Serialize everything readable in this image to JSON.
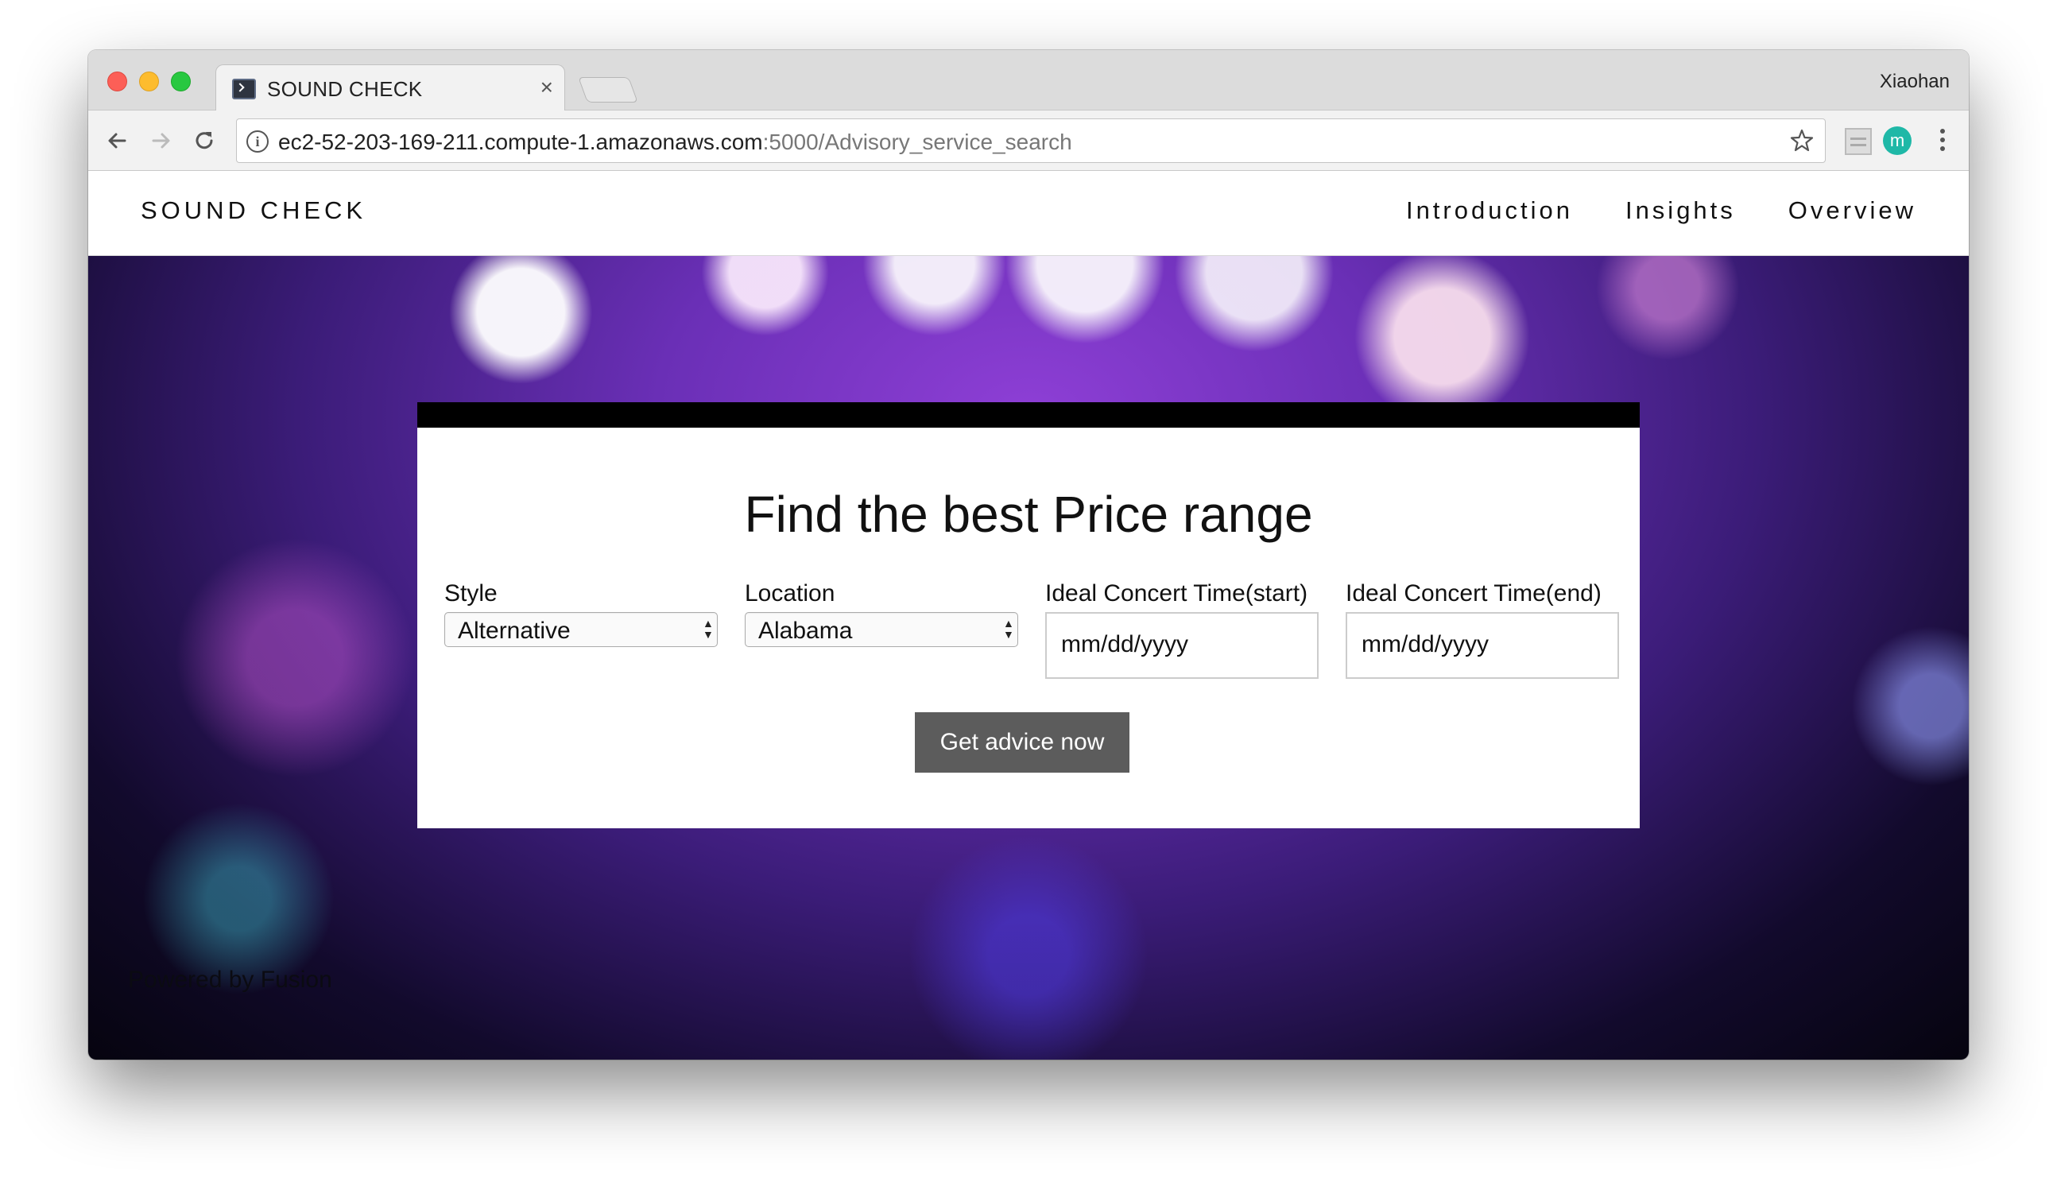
{
  "browser": {
    "tab_title": "SOUND CHECK",
    "tab_close_glyph": "×",
    "profile_name": "Xiaohan",
    "url_host": "ec2-52-203-169-211.compute-1.amazonaws.com",
    "url_path": ":5000/Advisory_service_search",
    "info_glyph": "i",
    "extension_letter": "m"
  },
  "site_nav": {
    "brand": "SOUND CHECK",
    "links": [
      "Introduction",
      "Insights",
      "Overview"
    ]
  },
  "search_card": {
    "title": "Find the best Price range",
    "style": {
      "label": "Style",
      "value": "Alternative"
    },
    "location": {
      "label": "Location",
      "value": "Alabama"
    },
    "start": {
      "label": "Ideal Concert Time(start)",
      "value": "mm/dd/yyyy"
    },
    "end": {
      "label": "Ideal Concert Time(end)",
      "value": "mm/dd/yyyy"
    },
    "button": "Get advice now",
    "select_arrows": "▲▼"
  },
  "footer": {
    "text": "Powered by Fusion"
  },
  "colors": {
    "card_header": "#000000",
    "button_bg": "#5c5c5c",
    "extension_avatar": "#1fb8a7"
  }
}
